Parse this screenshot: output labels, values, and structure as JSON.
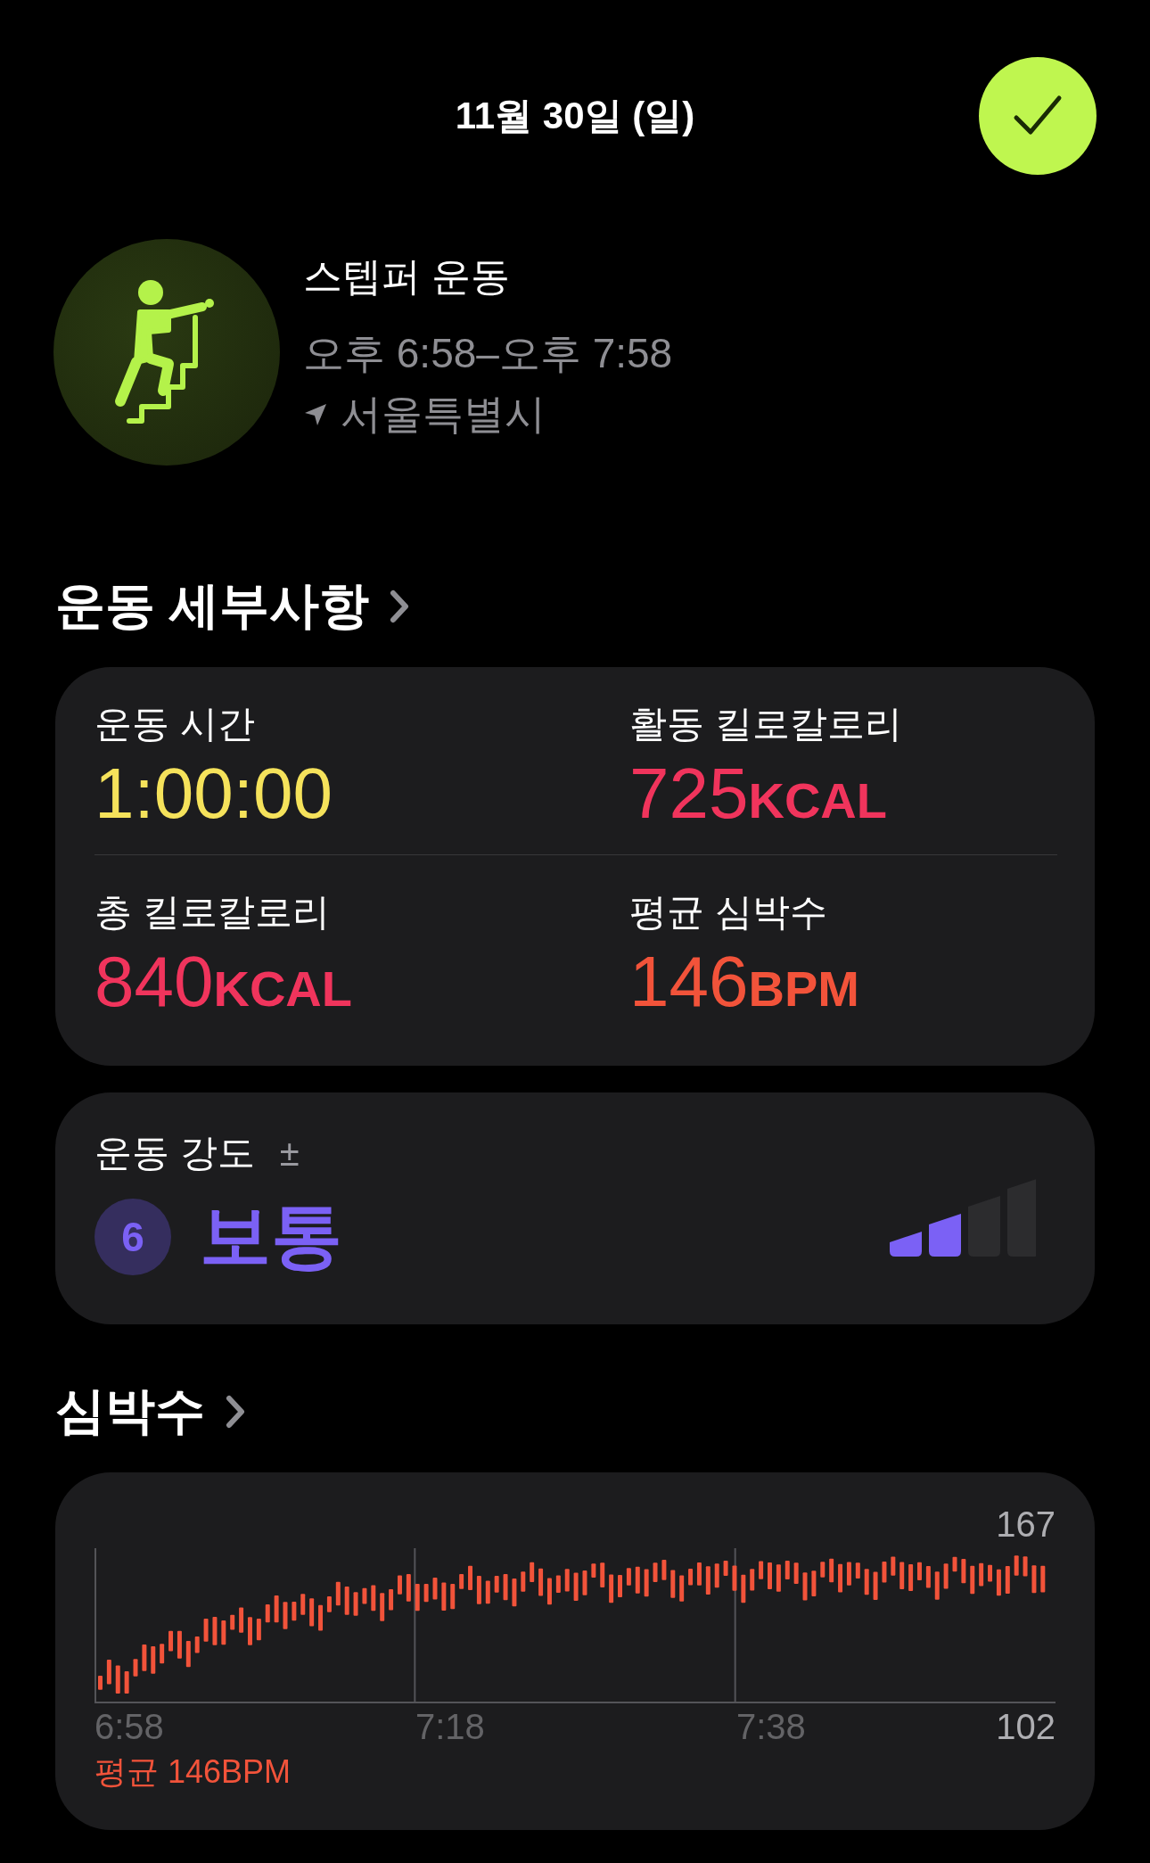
{
  "header": {
    "date": "11월 30일 (일)"
  },
  "workout": {
    "name": "스텝퍼 운동",
    "time": "오후 6:58–오후 7:58",
    "location": "서울특별시"
  },
  "details": {
    "title": "운동 세부사항",
    "metrics": [
      {
        "label": "운동 시간",
        "value": "1:00:00",
        "color": "#f5e25b"
      },
      {
        "label": "활동 킬로칼로리",
        "value": "725",
        "unit": "KCAL",
        "color": "#f0345c"
      },
      {
        "label": "총 킬로칼로리",
        "value": "840",
        "unit": "KCAL",
        "color": "#f0345c"
      },
      {
        "label": "평균 심박수",
        "value": "146",
        "unit": "BPM",
        "color": "#f2533a"
      }
    ]
  },
  "intensity": {
    "label": "운동 강도",
    "adjust_symbol": "±",
    "number": "6",
    "value": "보통",
    "level": 0.5
  },
  "heart_rate": {
    "title": "심박수",
    "max": "167",
    "min": "102",
    "x_labels": [
      "6:58",
      "7:18",
      "7:38"
    ],
    "average": "평균 146BPM"
  }
}
